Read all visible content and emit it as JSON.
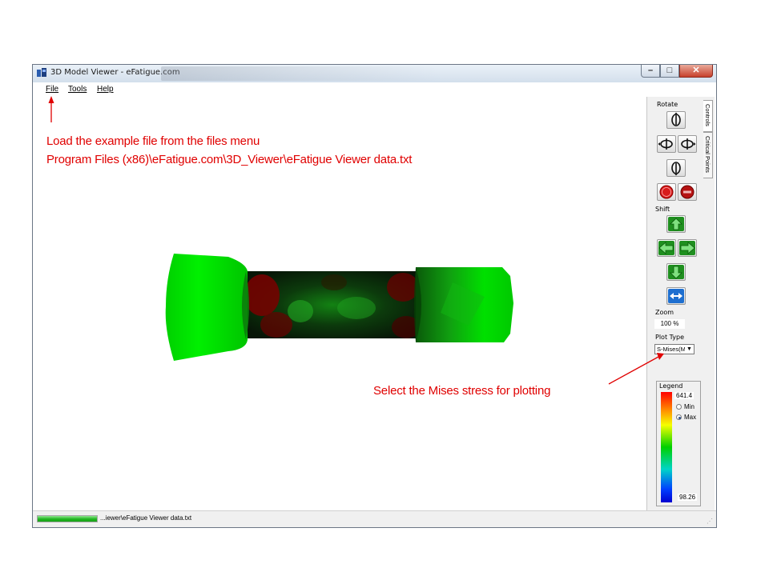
{
  "window": {
    "title": "3D Model Viewer - eFatigue.com",
    "minimize_glyph": "–",
    "maximize_glyph": "□",
    "close_glyph": "✕"
  },
  "menu": {
    "items": [
      "File",
      "Tools",
      "Help"
    ]
  },
  "controls": {
    "rotate_label": "Rotate",
    "shift_label": "Shift",
    "zoom_label": "Zoom",
    "zoom_value": "100 %",
    "plot_type_label": "Plot Type",
    "plot_type_value": "S-Mises(M",
    "select_arrow": "▼"
  },
  "legend": {
    "title": "Legend",
    "max_value": "641.4",
    "min_value": "98.26",
    "radio_min": "Min",
    "radio_max": "Max",
    "selected": "Max"
  },
  "tabs": [
    "Controls",
    "Critical Points"
  ],
  "status": {
    "progress_fraction": 1.0,
    "file_text": "...iewer\\eFatigue Viewer data.txt",
    "grip": "⋰"
  },
  "annotations": {
    "load_line1": "Load the example file from the files menu",
    "load_line2": "Program Files (x86)\\eFatigue.com\\3D_Viewer\\eFatigue Viewer data.txt",
    "mises_note": "Select the Mises stress for plotting"
  },
  "colors": {
    "annotation_red": "#e00000",
    "model_green": "#00e600",
    "model_dark": "#0a2a0a",
    "model_red": "#8a0000"
  }
}
